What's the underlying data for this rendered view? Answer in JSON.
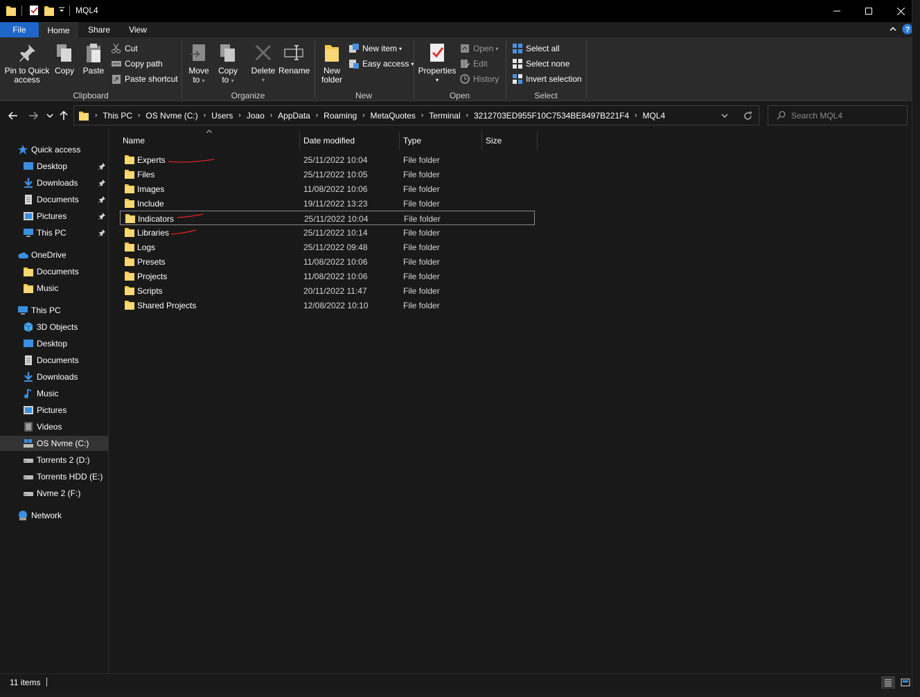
{
  "window": {
    "title": "MQL4"
  },
  "ribbon_tabs": {
    "file": "File",
    "home": "Home",
    "share": "Share",
    "view": "View"
  },
  "ribbon": {
    "clipboard": {
      "label": "Clipboard",
      "pin_line1": "Pin to Quick",
      "pin_line2": "access",
      "copy": "Copy",
      "paste": "Paste",
      "cut": "Cut",
      "copy_path": "Copy path",
      "paste_shortcut": "Paste shortcut"
    },
    "organize": {
      "label": "Organize",
      "move_line1": "Move",
      "move_line2": "to",
      "copy_line1": "Copy",
      "copy_line2": "to",
      "delete": "Delete",
      "rename": "Rename"
    },
    "new": {
      "label": "New",
      "folder_line1": "New",
      "folder_line2": "folder",
      "new_item": "New item",
      "easy_access": "Easy access"
    },
    "open": {
      "label": "Open",
      "properties": "Properties",
      "open": "Open",
      "edit": "Edit",
      "history": "History"
    },
    "select": {
      "label": "Select",
      "select_all": "Select all",
      "select_none": "Select none",
      "invert": "Invert selection"
    }
  },
  "address": {
    "crumbs": [
      "This PC",
      "OS Nvme (C:)",
      "Users",
      "Joao",
      "AppData",
      "Roaming",
      "MetaQuotes",
      "Terminal",
      "3212703ED955F10C7534BE8497B221F4",
      "MQL4"
    ]
  },
  "search": {
    "placeholder": "Search MQL4"
  },
  "nav": {
    "quick_access": "Quick access",
    "qa_desktop": "Desktop",
    "qa_downloads": "Downloads",
    "qa_documents": "Documents",
    "qa_pictures": "Pictures",
    "qa_thispc": "This PC",
    "onedrive": "OneDrive",
    "od_documents": "Documents",
    "od_music": "Music",
    "this_pc": "This PC",
    "pc_3d": "3D Objects",
    "pc_desktop": "Desktop",
    "pc_documents": "Documents",
    "pc_downloads": "Downloads",
    "pc_music": "Music",
    "pc_pictures": "Pictures",
    "pc_videos": "Videos",
    "drive_c": "OS Nvme (C:)",
    "drive_d": "Torrents 2 (D:)",
    "drive_e": "Torrents HDD (E:)",
    "drive_f": "Nvme 2 (F:)",
    "network": "Network"
  },
  "columns": {
    "name": "Name",
    "date": "Date modified",
    "type": "Type",
    "size": "Size"
  },
  "files": [
    {
      "name": "Experts",
      "date": "25/11/2022 10:04",
      "type": "File folder"
    },
    {
      "name": "Files",
      "date": "25/11/2022 10:05",
      "type": "File folder"
    },
    {
      "name": "Images",
      "date": "11/08/2022 10:06",
      "type": "File folder"
    },
    {
      "name": "Include",
      "date": "19/11/2022 13:23",
      "type": "File folder"
    },
    {
      "name": "Indicators",
      "date": "25/11/2022 10:04",
      "type": "File folder"
    },
    {
      "name": "Libraries",
      "date": "25/11/2022 10:14",
      "type": "File folder"
    },
    {
      "name": "Logs",
      "date": "25/11/2022 09:48",
      "type": "File folder"
    },
    {
      "name": "Presets",
      "date": "11/08/2022 10:06",
      "type": "File folder"
    },
    {
      "name": "Projects",
      "date": "11/08/2022 10:06",
      "type": "File folder"
    },
    {
      "name": "Scripts",
      "date": "20/11/2022 11:47",
      "type": "File folder"
    },
    {
      "name": "Shared Projects",
      "date": "12/08/2022 10:10",
      "type": "File folder"
    }
  ],
  "status": {
    "count": "11 items"
  },
  "colors": {
    "file_tab": "#1e66c8",
    "folder": "#f3c94a",
    "annotation": "#e02424",
    "selected_nav": "#333333"
  },
  "icons": {
    "folder": "folder-icon",
    "pin": "pin-icon",
    "search": "search-icon",
    "refresh": "refresh-icon"
  }
}
